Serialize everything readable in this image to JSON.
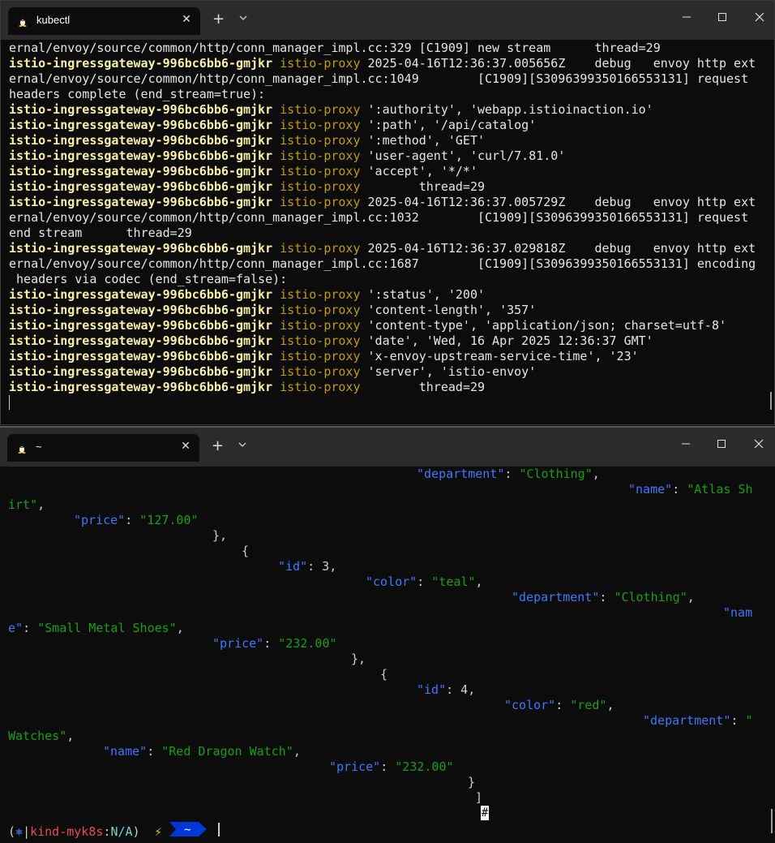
{
  "window1": {
    "tab_title": "kubectl",
    "close_glyph": "✕",
    "newtab_glyph": "+",
    "dropdown_glyph": "⌄",
    "min_glyph": "—",
    "max_glyph": "☐",
    "winclose_glyph": "✕",
    "lines": [
      {
        "type": "plain",
        "text": "ernal/envoy/source/common/http/conn_manager_impl.cc:329 [C1909] new stream      thread=29"
      },
      {
        "type": "log",
        "pod": "istio-ingressgateway-996bc6bb6-gmjkr",
        "container": "istio-proxy",
        "text": " 2025-04-16T12:36:37.005656Z    debug   envoy http ext"
      },
      {
        "type": "plain",
        "text": "ernal/envoy/source/common/http/conn_manager_impl.cc:1049        [C1909][S3096399350166553131] request"
      },
      {
        "type": "plain",
        "text": "headers complete (end_stream=true):"
      },
      {
        "type": "log",
        "pod": "istio-ingressgateway-996bc6bb6-gmjkr",
        "container": "istio-proxy",
        "text": " ':authority', 'webapp.istioinaction.io'"
      },
      {
        "type": "log",
        "pod": "istio-ingressgateway-996bc6bb6-gmjkr",
        "container": "istio-proxy",
        "text": " ':path', '/api/catalog'"
      },
      {
        "type": "log",
        "pod": "istio-ingressgateway-996bc6bb6-gmjkr",
        "container": "istio-proxy",
        "text": " ':method', 'GET'"
      },
      {
        "type": "log",
        "pod": "istio-ingressgateway-996bc6bb6-gmjkr",
        "container": "istio-proxy",
        "text": " 'user-agent', 'curl/7.81.0'"
      },
      {
        "type": "log",
        "pod": "istio-ingressgateway-996bc6bb6-gmjkr",
        "container": "istio-proxy",
        "text": " 'accept', '*/*'"
      },
      {
        "type": "log",
        "pod": "istio-ingressgateway-996bc6bb6-gmjkr",
        "container": "istio-proxy",
        "text": "        thread=29"
      },
      {
        "type": "log",
        "pod": "istio-ingressgateway-996bc6bb6-gmjkr",
        "container": "istio-proxy",
        "text": " 2025-04-16T12:36:37.005729Z    debug   envoy http ext"
      },
      {
        "type": "plain",
        "text": "ernal/envoy/source/common/http/conn_manager_impl.cc:1032        [C1909][S3096399350166553131] request"
      },
      {
        "type": "plain",
        "text": "end stream      thread=29"
      },
      {
        "type": "log",
        "pod": "istio-ingressgateway-996bc6bb6-gmjkr",
        "container": "istio-proxy",
        "text": " 2025-04-16T12:36:37.029818Z    debug   envoy http ext"
      },
      {
        "type": "plain",
        "text": "ernal/envoy/source/common/http/conn_manager_impl.cc:1687        [C1909][S3096399350166553131] encoding"
      },
      {
        "type": "plain",
        "text": " headers via codec (end_stream=false):"
      },
      {
        "type": "log",
        "pod": "istio-ingressgateway-996bc6bb6-gmjkr",
        "container": "istio-proxy",
        "text": " ':status', '200'"
      },
      {
        "type": "log",
        "pod": "istio-ingressgateway-996bc6bb6-gmjkr",
        "container": "istio-proxy",
        "text": " 'content-length', '357'"
      },
      {
        "type": "log",
        "pod": "istio-ingressgateway-996bc6bb6-gmjkr",
        "container": "istio-proxy",
        "text": " 'content-type', 'application/json; charset=utf-8'"
      },
      {
        "type": "log",
        "pod": "istio-ingressgateway-996bc6bb6-gmjkr",
        "container": "istio-proxy",
        "text": " 'date', 'Wed, 16 Apr 2025 12:36:37 GMT'"
      },
      {
        "type": "log",
        "pod": "istio-ingressgateway-996bc6bb6-gmjkr",
        "container": "istio-proxy",
        "text": " 'x-envoy-upstream-service-time', '23'"
      },
      {
        "type": "log",
        "pod": "istio-ingressgateway-996bc6bb6-gmjkr",
        "container": "istio-proxy",
        "text": " 'server', 'istio-envoy'"
      },
      {
        "type": "log",
        "pod": "istio-ingressgateway-996bc6bb6-gmjkr",
        "container": "istio-proxy",
        "text": "        thread=29"
      }
    ]
  },
  "window2": {
    "tab_title": "~",
    "close_glyph": "✕",
    "newtab_glyph": "+",
    "dropdown_glyph": "⌄",
    "min_glyph": "—",
    "max_glyph": "☐",
    "winclose_glyph": "✕",
    "json_output": {
      "l1_key": "\"department\"",
      "l1_sep": ": ",
      "l1_val": "\"Clothing\"",
      "l1_tail": ",",
      "l2_key": "\"name\"",
      "l2_sep": ": ",
      "l2_val": "\"Atlas Sh",
      "l3_val": "irt\"",
      "l3_tail": ",",
      "l4_key": "\"price\"",
      "l4_sep": ": ",
      "l4_val": "\"127.00\"",
      "l5": "},",
      "l6": "{",
      "l7_key": "\"id\"",
      "l7_tail": ": 3,",
      "l8_key": "\"color\"",
      "l8_sep": ": ",
      "l8_val": "\"teal\"",
      "l8_tail": ",",
      "l9_key": "\"department\"",
      "l9_sep": ": ",
      "l9_val": "\"Clothing\"",
      "l9_tail": ",",
      "l10_key": "\"nam",
      "l11_key": "e\"",
      "l11_sep": ": ",
      "l11_val": "\"Small Metal Shoes\"",
      "l11_tail": ",",
      "l12_key": "\"price\"",
      "l12_sep": ": ",
      "l12_val": "\"232.00\"",
      "l13": "},",
      "l14": "{",
      "l15_key": "\"id\"",
      "l15_tail": ": 4,",
      "l16_key": "\"color\"",
      "l16_sep": ": ",
      "l16_val": "\"red\"",
      "l16_tail": ",",
      "l17_key": "\"department\"",
      "l17_sep": ": ",
      "l17_val": "\"",
      "l18_val": "Watches\"",
      "l18_tail": ",",
      "l19_key": "\"name\"",
      "l19_sep": ": ",
      "l19_val": "\"Red Dragon Watch\"",
      "l19_tail": ",",
      "l20_key": "\"price\"",
      "l20_sep": ": ",
      "l20_val": "\"232.00\"",
      "l21": "}",
      "l22": "]"
    },
    "prompt": {
      "open": "(",
      "k8s_icon": "⎈",
      "sep": "|",
      "context": "kind-myk8s",
      "colon": ":",
      "namespace": "N/A",
      "close": ")",
      "bolt": "⚡",
      "dir": "~",
      "hash": "#"
    }
  },
  "colors": {
    "terminal_bg": "#0c0c0c",
    "pod_name": "#f9f1a5",
    "container_name": "#c19c00",
    "json_key": "#3b78ff",
    "json_string": "#13a10e",
    "prompt_context": "#e74856",
    "prompt_dir_bg": "#0037da"
  }
}
